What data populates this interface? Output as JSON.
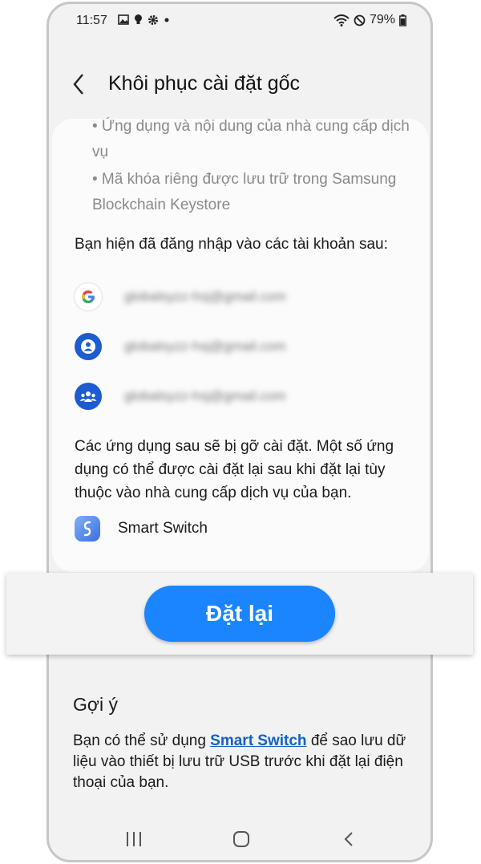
{
  "status_bar": {
    "time": "11:57",
    "battery": "79%",
    "icons": [
      "gallery-icon",
      "bulb-icon",
      "settings-icon",
      "dot-icon",
      "wifi-icon",
      "dnd-icon",
      "battery-icon"
    ]
  },
  "header": {
    "title": "Khôi phục cài đặt gốc",
    "back_icon": "chevron-left-icon"
  },
  "content": {
    "bullets": [
      "• Ứng dụng và nội dung của nhà cung cấp dịch vụ",
      "• Mã khóa riêng được lưu trữ trong Samsung Blockchain Keystore"
    ],
    "accounts_heading": "Bạn hiện đã đăng nhập vào các tài khoản sau:",
    "accounts": [
      {
        "icon": "google-icon",
        "email": "globalsyzz-hsj@gmail.com"
      },
      {
        "icon": "samsung-account-icon",
        "email": "globalsyzz-hsj@gmail.com"
      },
      {
        "icon": "family-group-icon",
        "email": "globalsyzz-hsj@gmail.com"
      }
    ],
    "apps_heading": "Các ứng dụng sau sẽ bị gỡ cài đặt. Một số ứng dụng có thể được cài đặt lại sau khi đặt lại tùy thuộc vào nhà cung cấp dịch vụ của bạn.",
    "apps": [
      {
        "icon": "smart-switch-icon",
        "label": "Smart Switch"
      }
    ]
  },
  "reset_button": {
    "label": "Đặt lại"
  },
  "hint": {
    "title": "Gợi ý",
    "text_before": "Bạn có thể sử dụng ",
    "link": "Smart Switch",
    "text_after": " để sao lưu dữ liệu vào thiết bị lưu trữ USB trước khi đặt lại điện thoại của bạn."
  },
  "nav_bar": {
    "items": [
      "recents-icon",
      "home-icon",
      "back-icon"
    ]
  },
  "colors": {
    "accent": "#1a85ff",
    "link": "#1261c4",
    "background": "#f2f2f2",
    "card": "#fbfbfb"
  }
}
